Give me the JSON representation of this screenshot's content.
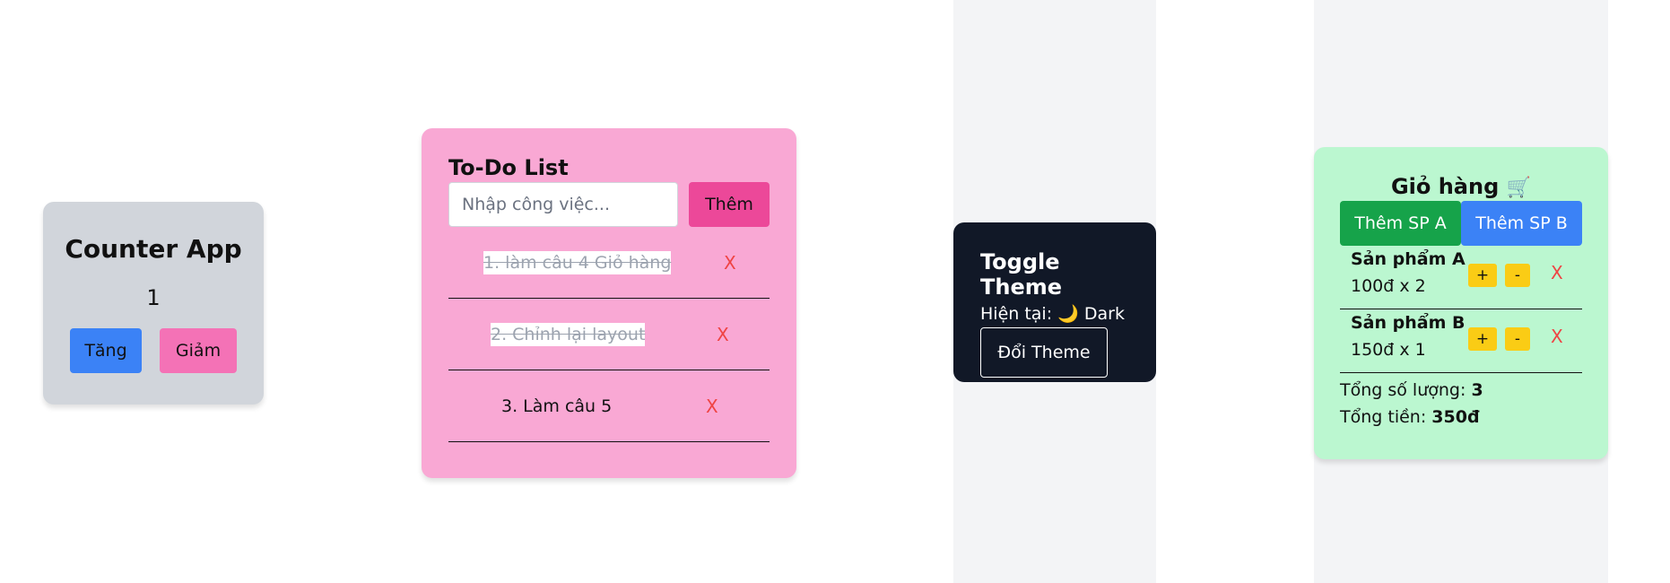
{
  "counter": {
    "title": "Counter App",
    "value": "1",
    "increase_label": "Tăng",
    "decrease_label": "Giảm"
  },
  "todo": {
    "title": "To-Do List",
    "input_placeholder": "Nhập công việc...",
    "add_label": "Thêm",
    "items": [
      {
        "text": "1. làm câu 4 Giỏ hàng",
        "done": true,
        "delete": "X"
      },
      {
        "text": "2. Chỉnh lại layout",
        "done": true,
        "delete": "X"
      },
      {
        "text": "3. Làm câu 5",
        "done": false,
        "delete": "X"
      }
    ]
  },
  "theme": {
    "title": "Toggle Theme",
    "current_prefix": "Hiện tại:",
    "current_icon": "🌙",
    "current_value": "Dark",
    "toggle_label": "Đổi Theme"
  },
  "cart": {
    "title": "Giỏ hàng",
    "title_icon": "🛒",
    "add_a_label": "Thêm SP A",
    "add_b_label": "Thêm SP B",
    "items": [
      {
        "name": "Sản phẩm A",
        "price_qty": "100đ x 2",
        "plus": "+",
        "minus": "-",
        "remove": "X"
      },
      {
        "name": "Sản phẩm B",
        "price_qty": "150đ x 1",
        "plus": "+",
        "minus": "-",
        "remove": "X"
      }
    ],
    "total_qty_label": "Tổng số lượng:",
    "total_qty_value": "3",
    "total_price_label": "Tổng tiền:",
    "total_price_value": "350đ"
  },
  "colors": {
    "counter_bg": "#d1d5db",
    "todo_bg": "#f9a8d4",
    "theme_bg": "#111827",
    "cart_bg": "#bbf7d0",
    "accent_blue": "#3b82f6",
    "accent_pink": "#ec4899",
    "accent_green": "#16a34a",
    "accent_yellow": "#facc15",
    "danger_red": "#ef4444"
  }
}
